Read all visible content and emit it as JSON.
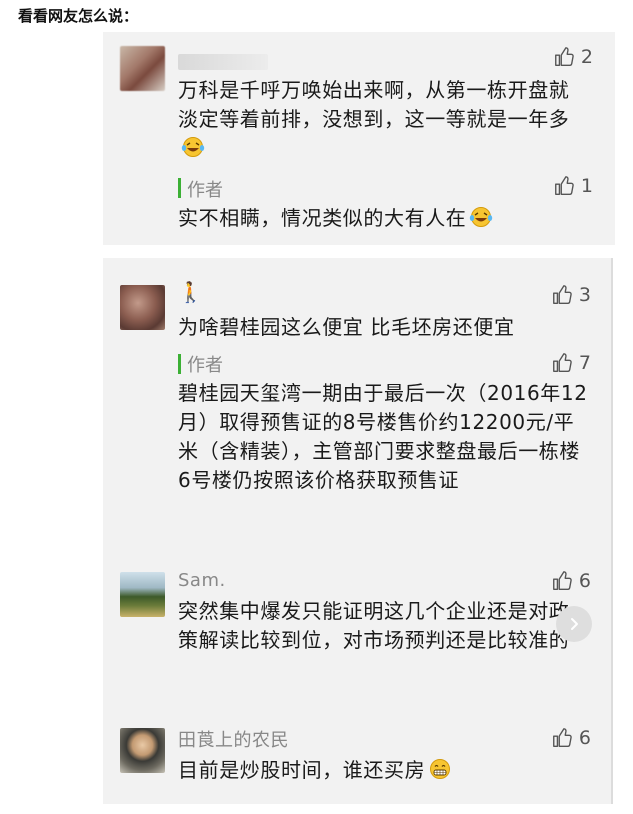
{
  "heading": "看看网友怎么说：",
  "comments": [
    {
      "user": "",
      "likes": "2",
      "text": "万科是千呼万唤始出来啊，从第一栋开盘就淡定等着前排，没想到，这一等就是一年多",
      "reply": {
        "author": "作者",
        "likes": "1",
        "text": "实不相瞒，情况类似的大有人在"
      }
    },
    {
      "user": "🚶",
      "likes": "3",
      "text": "为啥碧桂园这么便宜 比毛坯房还便宜",
      "reply": {
        "author": "作者",
        "likes": "7",
        "text": "碧桂园天玺湾一期由于最后一次（2016年12月）取得预售证的8号楼售价约12200元/平米（含精装），主管部门要求整盘最后一栋楼6号楼仍按照该价格获取预售证"
      }
    },
    {
      "user": "Sam.",
      "likes": "6",
      "text": "突然集中爆发只能证明这几个企业还是对政策解读比较到位，对市场预判还是比较准的"
    },
    {
      "user": "田莨上的农民",
      "likes": "6",
      "text": "目前是炒股时间，谁还买房"
    }
  ],
  "icons": {
    "like": "thumbs-up-icon",
    "scroll": "chevron-right-icon"
  },
  "colors": {
    "reply_bar": "#3cb035",
    "panel": "#f2f2f2"
  }
}
